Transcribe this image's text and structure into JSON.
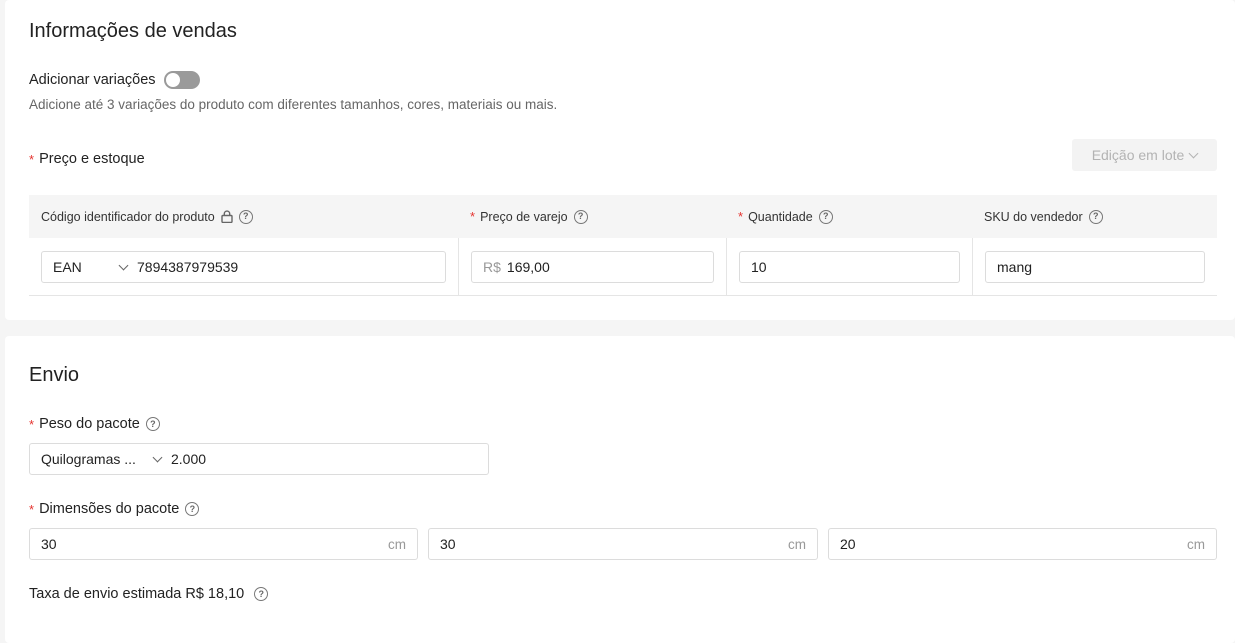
{
  "sales": {
    "title": "Informações de vendas",
    "variations_label": "Adicionar variações",
    "variations_enabled": false,
    "variations_help": "Adicione até 3 variações do produto com diferentes tamanhos, cores, materiais ou mais.",
    "price_stock_label": "Preço e estoque",
    "batch_edit_label": "Edição em lote",
    "columns": {
      "product_id": "Código identificador do produto",
      "retail_price": "Preço de varejo",
      "quantity": "Quantidade",
      "seller_sku": "SKU do vendedor"
    },
    "row": {
      "id_type": "EAN",
      "id_value": "7894387979539",
      "currency_prefix": "R$",
      "price": "169,00",
      "quantity": "10",
      "sku": "mang"
    }
  },
  "shipping": {
    "title": "Envio",
    "weight_label": "Peso do pacote",
    "weight_unit": "Quilogramas ...",
    "weight_value": "2.000",
    "dimensions_label": "Dimensões do pacote",
    "dimensions": [
      {
        "value": "30",
        "unit": "cm"
      },
      {
        "value": "30",
        "unit": "cm"
      },
      {
        "value": "20",
        "unit": "cm"
      }
    ],
    "estimated_fee": "Taxa de envio estimada R$ 18,10"
  },
  "colors": {
    "required_marker": "#e5332f",
    "toggle_off": "#9a9a9a"
  }
}
